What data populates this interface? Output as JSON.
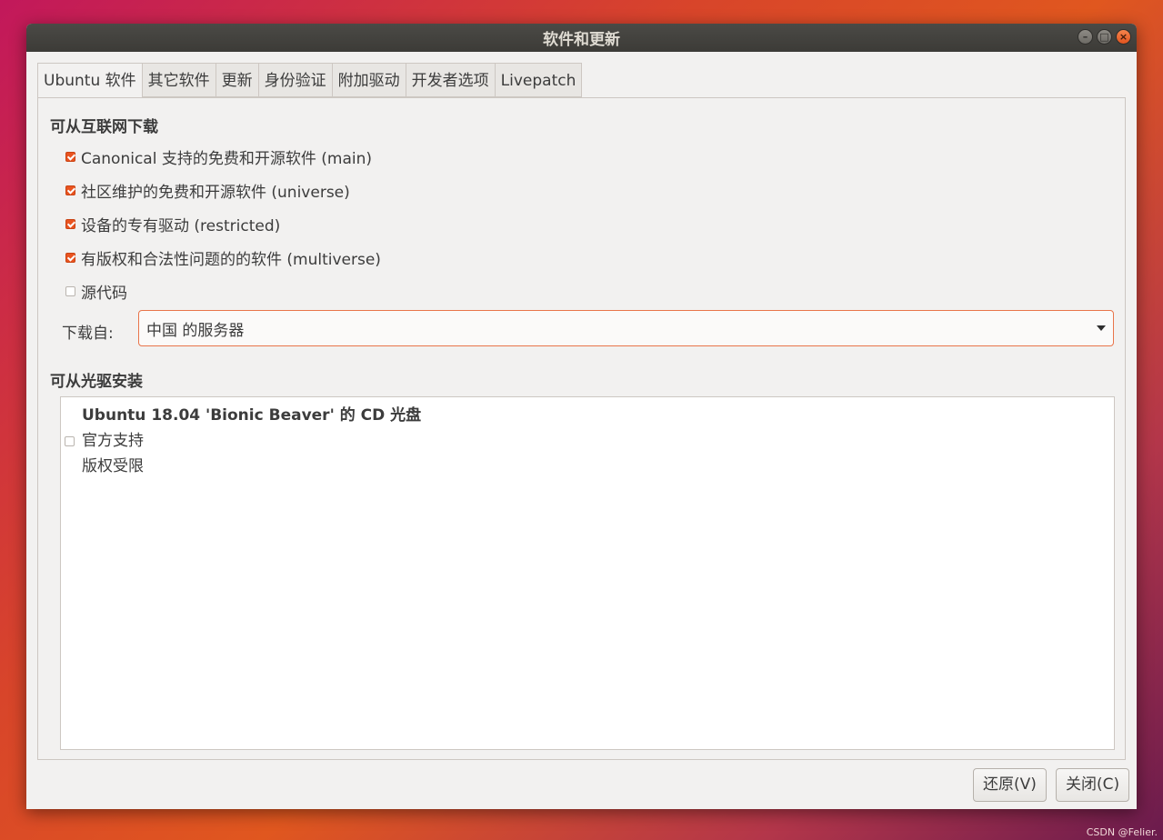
{
  "window": {
    "title": "软件和更新",
    "controls": {
      "minimize": "–",
      "maximize": "□",
      "close": "×"
    }
  },
  "tabs": [
    {
      "label": "Ubuntu 软件",
      "active": true
    },
    {
      "label": "其它软件"
    },
    {
      "label": "更新"
    },
    {
      "label": "身份验证"
    },
    {
      "label": "附加驱动"
    },
    {
      "label": "开发者选项"
    },
    {
      "label": "Livepatch"
    }
  ],
  "internet": {
    "title": "可从互联网下载",
    "items": [
      {
        "label": "Canonical 支持的免费和开源软件 (main)",
        "checked": true
      },
      {
        "label": "社区维护的免费和开源软件 (universe)",
        "checked": true
      },
      {
        "label": "设备的专有驱动 (restricted)",
        "checked": true
      },
      {
        "label": "有版权和合法性问题的的软件 (multiverse)",
        "checked": true
      },
      {
        "label": "源代码",
        "checked": false
      }
    ],
    "download_from_label": "下载自:",
    "download_from_value": "中国 的服务器"
  },
  "cdrom": {
    "title": "可从光驱安装",
    "item": {
      "name": "Ubuntu 18.04 'Bionic Beaver' 的 CD 光盘",
      "line2": "官方支持",
      "line3": "版权受限",
      "checked": false
    }
  },
  "footer": {
    "revert": "还原(V)",
    "close": "关闭(C)"
  },
  "watermark": "CSDN @Felier."
}
